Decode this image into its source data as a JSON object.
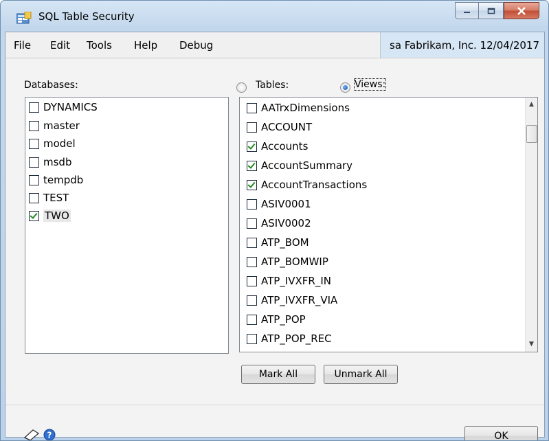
{
  "window": {
    "title": "SQL Table Security"
  },
  "menu": {
    "items": [
      "File",
      "Edit",
      "Tools",
      "Help",
      "Debug"
    ]
  },
  "status": {
    "text": "sa  Fabrikam, Inc.  12/04/2017"
  },
  "databases": {
    "label": "Databases:",
    "items": [
      {
        "label": "DYNAMICS",
        "checked": false
      },
      {
        "label": "master",
        "checked": false
      },
      {
        "label": "model",
        "checked": false
      },
      {
        "label": "msdb",
        "checked": false
      },
      {
        "label": "tempdb",
        "checked": false
      },
      {
        "label": "TEST",
        "checked": false
      },
      {
        "label": "TWO",
        "checked": true
      }
    ]
  },
  "object_type": {
    "tables_label": "Tables:",
    "views_label": "Views:",
    "selected": "Views"
  },
  "objects": {
    "items": [
      {
        "label": "AATrxDimensions",
        "checked": false
      },
      {
        "label": "ACCOUNT",
        "checked": false
      },
      {
        "label": "Accounts",
        "checked": true
      },
      {
        "label": "AccountSummary",
        "checked": true
      },
      {
        "label": "AccountTransactions",
        "checked": true
      },
      {
        "label": "ASIV0001",
        "checked": false
      },
      {
        "label": "ASIV0002",
        "checked": false
      },
      {
        "label": "ATP_BOM",
        "checked": false
      },
      {
        "label": "ATP_BOMWIP",
        "checked": false
      },
      {
        "label": "ATP_IVXFR_IN",
        "checked": false
      },
      {
        "label": "ATP_IVXFR_VIA",
        "checked": false
      },
      {
        "label": "ATP_POP",
        "checked": false
      },
      {
        "label": "ATP_POP_REC",
        "checked": false
      }
    ]
  },
  "buttons": {
    "mark_all": "Mark All",
    "unmark_all": "Unmark All",
    "ok": "OK"
  },
  "colors": {
    "check": "#1e8a1e",
    "status_bg": "#d7e6f4",
    "frame": "#c3d7ec"
  },
  "icons": [
    "window-app-icon",
    "minimize-icon",
    "maximize-icon",
    "close-icon",
    "note-icon",
    "help-icon",
    "scroll-up-icon",
    "scroll-down-icon"
  ]
}
